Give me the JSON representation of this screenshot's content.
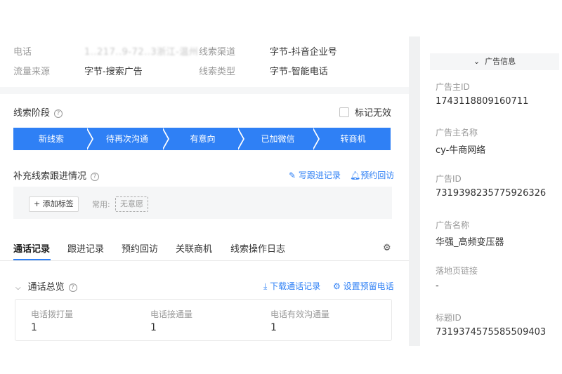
{
  "lead_info": {
    "phone_label": "电话",
    "phone_value": "1..217..9-72..3浙江-温州",
    "source_label": "流量来源",
    "source_value": "字节-搜索广告",
    "channel_label": "线索渠道",
    "channel_value": "字节-抖音企业号",
    "type_label": "线索类型",
    "type_value": "字节-智能电话"
  },
  "stage_section": {
    "title": "线索阶段",
    "mark_invalid_label": "标记无效",
    "stages": [
      "新线索",
      "待再次沟通",
      "有意向",
      "已加微信",
      "转商机"
    ],
    "accent": "#2f80f5"
  },
  "follow_section": {
    "title": "补充线索跟进情况",
    "write_record_label": "写跟进记录",
    "appointment_label": "预约回访",
    "add_tag_label": "添加标签",
    "common_label": "常用:",
    "no_intent_tag": "无意愿"
  },
  "tabs": [
    "通话记录",
    "跟进记录",
    "预约回访",
    "关联商机",
    "线索操作日志"
  ],
  "overview": {
    "title": "通话总览",
    "download_label": "下载通话记录",
    "set_phone_label": "设置预留电话",
    "stats": [
      {
        "label": "电话拨打量",
        "value": "1"
      },
      {
        "label": "电话接通量",
        "value": "1"
      },
      {
        "label": "电话有效沟通量",
        "value": "1"
      }
    ]
  },
  "ad_info": {
    "header": "广告信息",
    "items": [
      {
        "label": "广告主ID",
        "value": "1743118809160711"
      },
      {
        "label": "广告主名称",
        "value": "cy-牛商网络"
      },
      {
        "label": "广告ID",
        "value": "7319398235775926326"
      },
      {
        "label": "广告名称",
        "value": "华强_高频变压器"
      },
      {
        "label": "落地页链接",
        "value": "-"
      },
      {
        "label": "标题ID",
        "value": "7319374575585509403"
      }
    ]
  }
}
